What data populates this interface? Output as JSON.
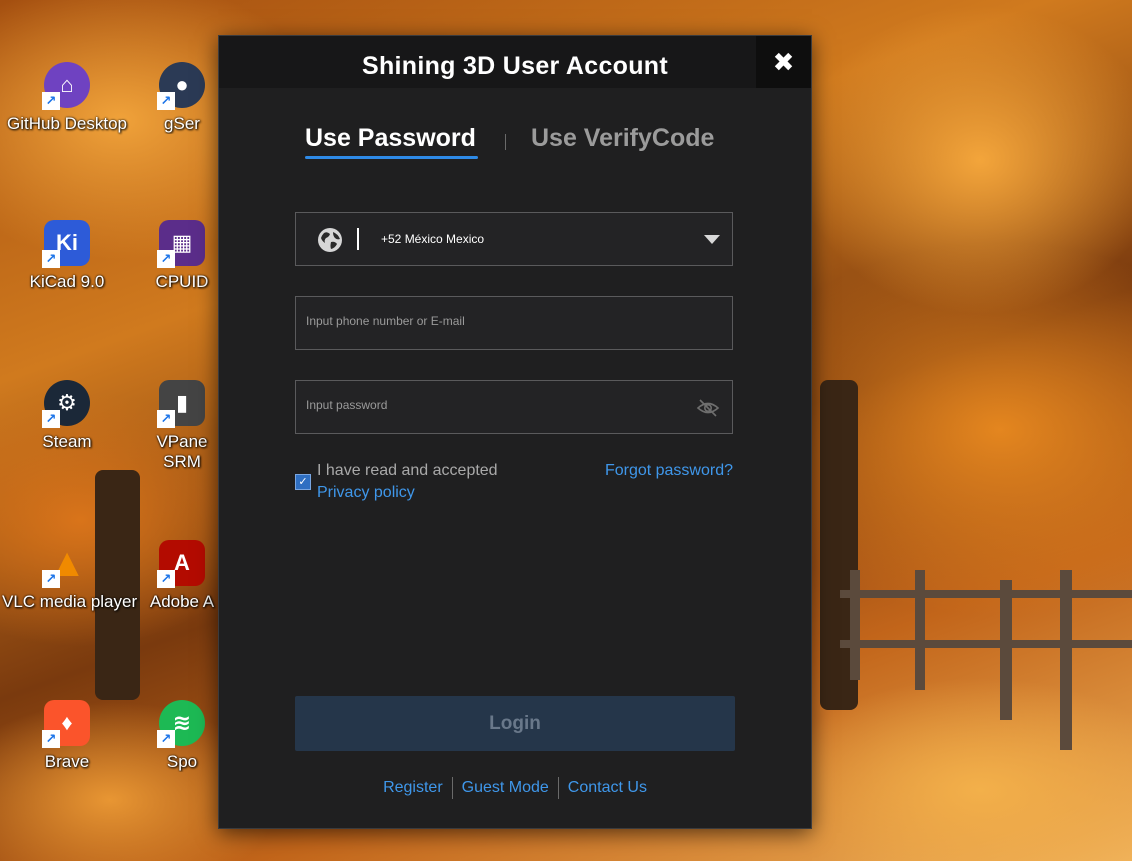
{
  "desktop": {
    "icons": [
      {
        "label": "GitHub Desktop",
        "icon": "github-desktop-icon",
        "color": "#6f42c1"
      },
      {
        "label": "gSer",
        "icon": "gserver-icon",
        "color": "#2b3a55"
      },
      {
        "label": "KiCad 9.0",
        "icon": "kicad-icon",
        "color": "#2d5bd8",
        "glyph": "Ki"
      },
      {
        "label": "CPUID",
        "icon": "cpuid-icon",
        "color": "#5b2d8a"
      },
      {
        "label": "Steam",
        "icon": "steam-icon",
        "color": "#1b2838"
      },
      {
        "label": "VPane",
        "label2": "SRM",
        "icon": "vpanel-icon",
        "color": "#444444"
      },
      {
        "label": "VLC media player",
        "icon": "vlc-icon",
        "color": "#f08a00"
      },
      {
        "label": "Adobe A",
        "icon": "adobe-acrobat-icon",
        "color": "#b30b00"
      },
      {
        "label": "Brave",
        "icon": "brave-icon",
        "color": "#fb542b"
      },
      {
        "label": "Spo",
        "icon": "spotify-icon",
        "color": "#1db954"
      }
    ]
  },
  "dialog": {
    "title": "Shining 3D User Account",
    "close_icon": "close-icon",
    "tabs": [
      {
        "label": "Use Password",
        "active": true
      },
      {
        "label": "Use VerifyCode",
        "active": false
      }
    ],
    "country": {
      "icon": "globe-icon",
      "value": "+52 México Mexico"
    },
    "phone_placeholder": "Input phone number or E-mail",
    "password_placeholder": "Input password",
    "password_toggle_icon": "eye-hidden-icon",
    "agreement": {
      "checked": true,
      "text": "I have read and accepted",
      "link": "Privacy policy"
    },
    "forgot": "Forgot password?",
    "login": "Login",
    "footer_links": [
      "Register",
      "Guest Mode",
      "Contact Us"
    ],
    "accent_color": "#3f97ea"
  }
}
